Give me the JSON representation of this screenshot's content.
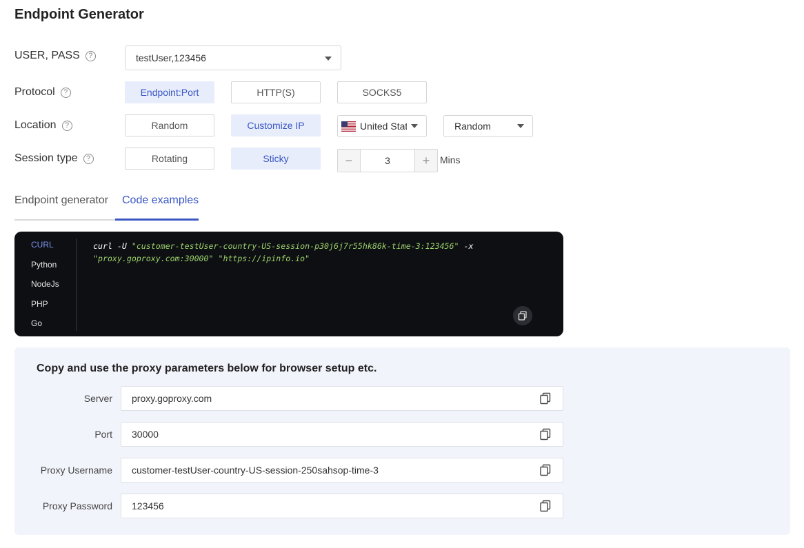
{
  "title": "Endpoint Generator",
  "user_pass": {
    "label": "USER, PASS",
    "value": "testUser,123456"
  },
  "protocol": {
    "label": "Protocol",
    "options": [
      "Endpoint:Port",
      "HTTP(S)",
      "SOCKS5"
    ],
    "selected": "Endpoint:Port"
  },
  "location": {
    "label": "Location",
    "options": [
      "Random",
      "Customize IP"
    ],
    "selected": "Customize IP",
    "country": "United Stat",
    "region": "Random"
  },
  "session": {
    "label": "Session type",
    "options": [
      "Rotating",
      "Sticky"
    ],
    "selected": "Sticky",
    "duration": "3",
    "unit": "Mins",
    "minus": "−",
    "plus": "+"
  },
  "tabs": [
    "Endpoint generator",
    "Code examples"
  ],
  "active_tab": "Code examples",
  "code": {
    "languages": [
      "CURL",
      "Python",
      "NodeJs",
      "PHP",
      "Go"
    ],
    "active": "CURL",
    "parts": {
      "cmd": "curl -U ",
      "cred": "\"customer-testUser-country-US-session-p30j6j7r55hk86k-time-3:123456\"",
      "flag": " -x ",
      "proxy": "\"proxy.goproxy.com:30000\"",
      "url": " \"https://ipinfo.io\""
    }
  },
  "params": {
    "title": "Copy and use the proxy parameters below for browser setup etc.",
    "rows": [
      {
        "label": "Server",
        "value": "proxy.goproxy.com"
      },
      {
        "label": "Port",
        "value": "30000"
      },
      {
        "label": "Proxy Username",
        "value": "customer-testUser-country-US-session-250sahsop-time-3"
      },
      {
        "label": "Proxy Password",
        "value": "123456"
      }
    ]
  },
  "colors": {
    "accent": "#3a57c4",
    "active_bg": "#e8edfb",
    "code_bg": "#0e0f12",
    "code_string": "#9bd06c",
    "panel_bg": "#f2f4fb"
  },
  "icons": {
    "help": "question-circle-icon",
    "copy": "copy-icon",
    "dropdown": "chevron-down-icon",
    "flag": "us-flag-icon"
  },
  "help_glyph": "?"
}
